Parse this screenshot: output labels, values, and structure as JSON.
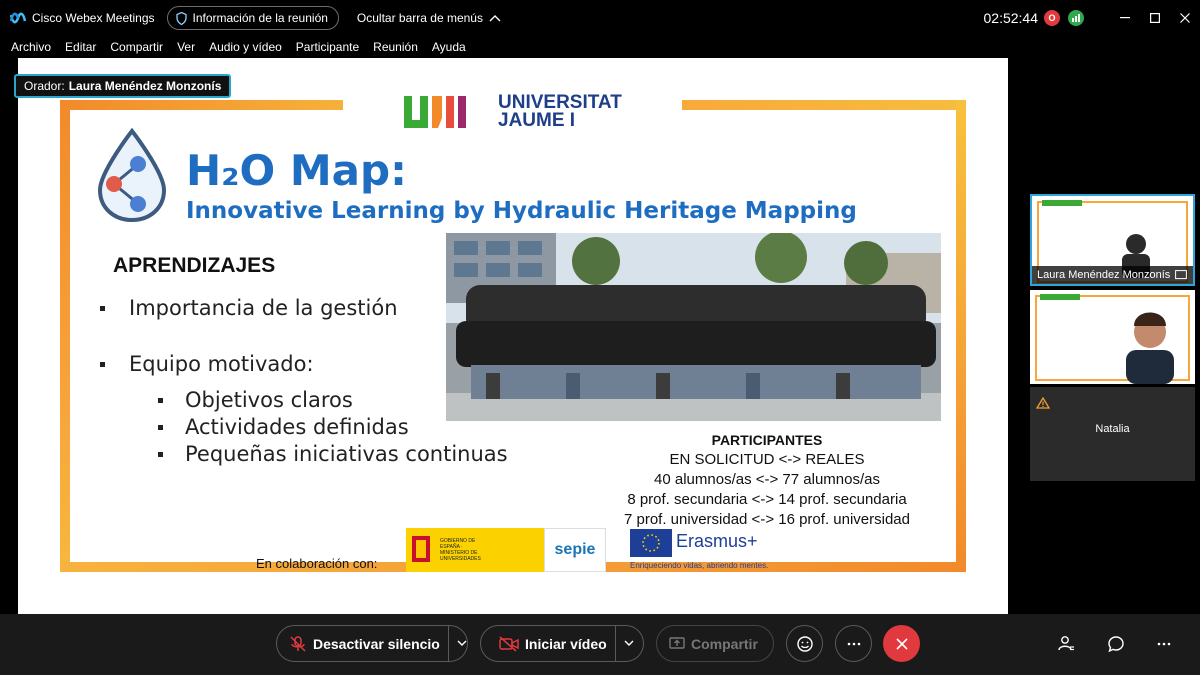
{
  "app": {
    "name": "Cisco Webex Meetings",
    "info_pill": "Información de la reunión",
    "hide_menu": "Ocultar barra de menús",
    "clock": "02:52:44",
    "rec_letter": "O"
  },
  "menu": {
    "items": [
      "Archivo",
      "Editar",
      "Compartir",
      "Ver",
      "Audio y vídeo",
      "Participante",
      "Reunión",
      "Ayuda"
    ]
  },
  "speaker": {
    "prefix": "Orador:",
    "name": "Laura Menéndez Monzonís"
  },
  "slide": {
    "logo_line1": "UNIVERSITAT",
    "logo_line2": "JAUME I",
    "title": "H₂O Map:",
    "subtitle": "Innovative Learning by Hydraulic Heritage Mapping",
    "section_heading": "APRENDIZAJES",
    "bullets": [
      "Importancia de la gestión",
      "Equipo motivado:"
    ],
    "sub_bullets": [
      "Objetivos claros",
      "Actividades definidas",
      "Pequeñas iniciativas continuas"
    ],
    "participants_heading": "PARTICIPANTES",
    "participants_lines": [
      "EN SOLICITUD <->  REALES",
      "40 alumnos/as <-> 77 alumnos/as",
      "8 prof. secundaria <-> 14 prof. secundaria",
      "7 prof. universidad <-> 16 prof. universidad"
    ],
    "collab_label": "En colaboración con:",
    "gov_text": "GOBIERNO DE ESPAÑA · MINISTERIO DE UNIVERSIDADES",
    "sepie": "sepie",
    "erasmus": "Erasmus+",
    "erasmus_tag": "Enriqueciendo vidas, abriendo mentes."
  },
  "participants_panel": {
    "tile1_name": "Laura Menéndez Monzonís",
    "tile3_name": "Natalia"
  },
  "controls": {
    "mute_label": "Desactivar silencio",
    "video_label": "Iniciar vídeo",
    "share_label": "Compartir"
  },
  "colors": {
    "accent_blue": "#1e6dc0",
    "frame_orange": "#f28a2a",
    "leave_red": "#e0393e",
    "active_border": "#2ea6da"
  }
}
